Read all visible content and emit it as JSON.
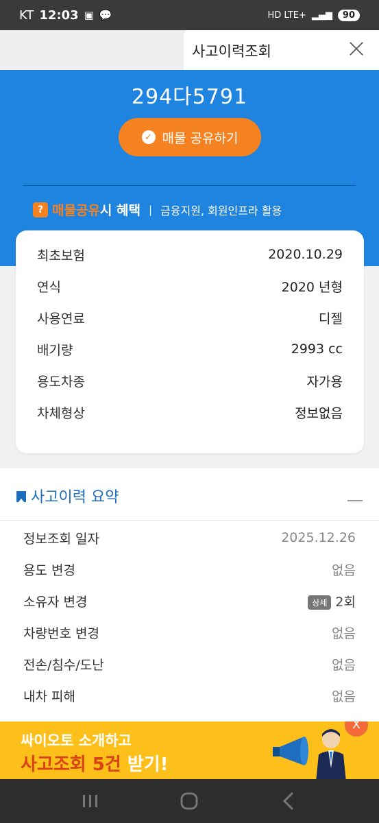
{
  "statusbar": {
    "carrier": "KT",
    "time": "12:03",
    "network": "HD LTE+",
    "battery": "90"
  },
  "header": {
    "title": "사고이력조회"
  },
  "vehicle": {
    "plate": "294다5791",
    "share_button": "매물 공유하기",
    "benefit_highlight": "매물공유",
    "benefit_rest": "시 혜택",
    "benefit_sub": "금융지원, 회원인프라 활용"
  },
  "info": {
    "rows": [
      {
        "label": "최초보험",
        "value": "2020.10.29"
      },
      {
        "label": "연식",
        "value": "2020 년형"
      },
      {
        "label": "사용연료",
        "value": "디젤"
      },
      {
        "label": "배기량",
        "value": "2993 cc"
      },
      {
        "label": "용도차종",
        "value": "자가용"
      },
      {
        "label": "차체형상",
        "value": "정보없음"
      }
    ]
  },
  "summary": {
    "title": "사고이력 요약",
    "rows": [
      {
        "label": "정보조회 일자",
        "value": "2025.12.26"
      },
      {
        "label": "용도 변경",
        "value": "없음"
      },
      {
        "label": "소유자 변경",
        "value": "2회",
        "badge": "상세"
      },
      {
        "label": "차량번호 변경",
        "value": "없음"
      },
      {
        "label": "전손/침수/도난",
        "value": "없음"
      },
      {
        "label": "내차 피해",
        "value": "없음"
      }
    ]
  },
  "promo": {
    "line1": "싸이오토 소개하고",
    "line2_highlight": "사고조회 5건",
    "line2_rest": "받기!",
    "close": "X"
  },
  "colors": {
    "blue": "#1f83e0",
    "orange": "#f58220",
    "promo_yellow": "#fdbf1a"
  }
}
